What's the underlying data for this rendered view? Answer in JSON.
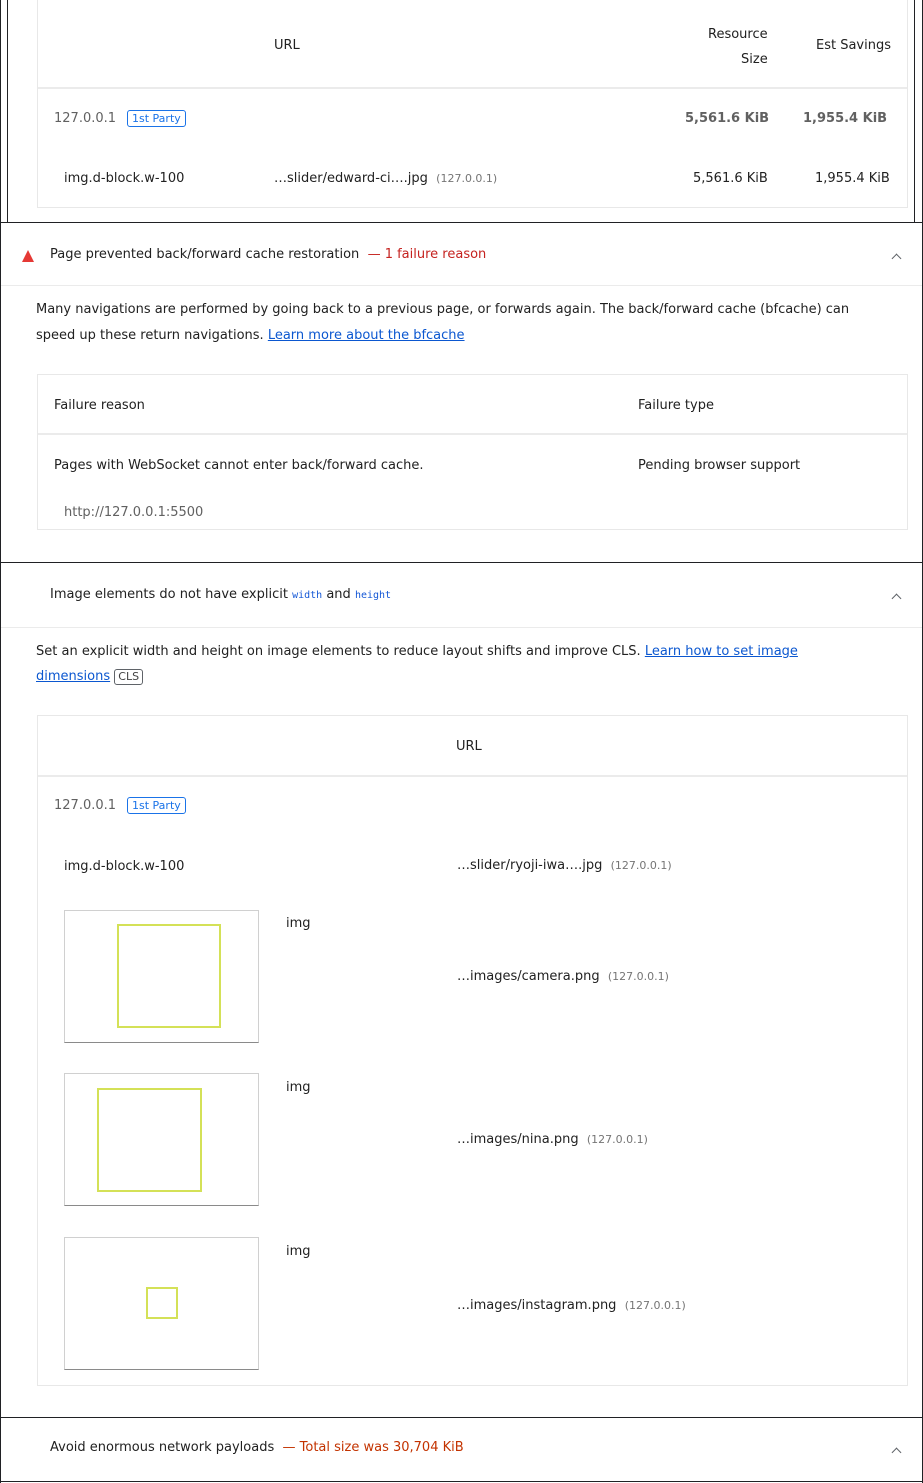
{
  "payload_table": {
    "headers": {
      "url": "URL",
      "resource_size": [
        "Resource",
        "Size"
      ],
      "est_savings": "Est Savings"
    },
    "group": {
      "host": "127.0.0.1",
      "badge": "1st Party",
      "resource_size": "5,561.6 KiB",
      "est_savings": "1,955.4 KiB"
    },
    "row": {
      "node": "img.d-block.w-100",
      "url": "…slider/edward-ci….jpg",
      "host": "(127.0.0.1)",
      "resource_size": "5,561.6 KiB",
      "est_savings": "1,955.4 KiB"
    }
  },
  "bfcache": {
    "title": "Page prevented back/forward cache restoration",
    "display_value": "— 1 failure reason",
    "description": "Many navigations are performed by going back to a previous page, or forwards again. The back/forward cache (bfcache) can",
    "description_line2": "speed up these return navigations.",
    "link": "Learn more about the bfcache",
    "headers": {
      "reason": "Failure reason",
      "type": "Failure type"
    },
    "row": {
      "reason": "Pages with WebSocket cannot enter back/forward cache.",
      "type": "Pending browser support",
      "url": "http://127.0.0.1:5500"
    }
  },
  "unsized_images": {
    "title_prefix": "Image elements do not have explicit",
    "code_width": "width",
    "title_and": "and",
    "code_height": "height",
    "description": "Set an explicit width and height on image elements to reduce layout shifts and improve CLS.",
    "link_line1": "Learn how to set image",
    "link_line2": "dimensions",
    "badge": "CLS",
    "headers": {
      "url": "URL"
    },
    "group": {
      "host": "127.0.0.1",
      "badge": "1st Party"
    },
    "rows": [
      {
        "node": "img.d-block.w-100",
        "url": "…slider/ryoji-iwa….jpg",
        "host": "(127.0.0.1)"
      },
      {
        "node": "img",
        "url": "…images/camera.png",
        "host": "(127.0.0.1)"
      },
      {
        "node": "img",
        "url": "…images/nina.png",
        "host": "(127.0.0.1)"
      },
      {
        "node": "img",
        "url": "…images/instagram.png",
        "host": "(127.0.0.1)"
      }
    ]
  },
  "network_payloads": {
    "title": "Avoid enormous network payloads",
    "display_value": "— Total size was 30,704 KiB"
  },
  "colors": {
    "fail_red": "#e53935",
    "link_blue": "#0b57d0",
    "party_blue": "#1a73e8",
    "thumb_outline": "#d4e157",
    "warn_orange": "#c33300"
  },
  "icons": [
    "fail-triangle-icon",
    "chevron-up-icon"
  ]
}
